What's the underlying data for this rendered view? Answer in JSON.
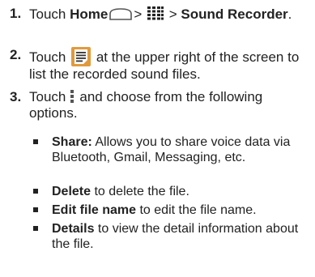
{
  "steps": [
    {
      "number": "1.",
      "touch": "Touch",
      "home": "Home",
      "sep1": ">",
      "sep2": ">",
      "app": "Sound Recorder",
      "end": "."
    },
    {
      "number": "2.",
      "touch": "Touch",
      "text": "at the upper right of the screen to list the recorded sound files."
    },
    {
      "number": "3.",
      "touch": "Touch",
      "text": "and choose from the following options."
    }
  ],
  "options": [
    {
      "label": "Share:",
      "text": "Allows you to share voice data via Bluetooth, Gmail, Messaging, etc."
    },
    {
      "label": "Delete",
      "text": "to delete the file."
    },
    {
      "label": "Edit file name",
      "text": "to edit the file name."
    },
    {
      "label": "Details",
      "text": "to view the detail information about the file."
    }
  ],
  "icons": {
    "home": "home-icon",
    "apps": "app-grid-icon",
    "list": "file-list-icon",
    "menu": "overflow-menu-icon"
  },
  "colors": {
    "text": "#222222",
    "list_icon_bg": "#e09a3c",
    "icon_gray": "#555555"
  }
}
